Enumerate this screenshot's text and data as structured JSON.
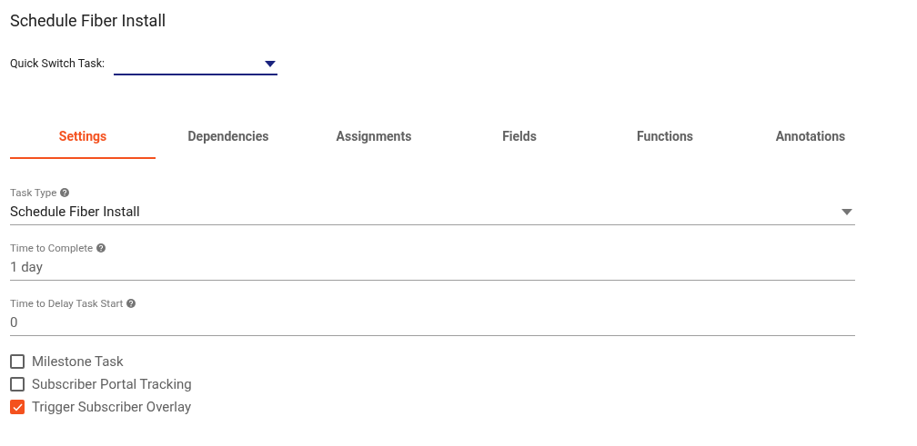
{
  "page": {
    "title": "Schedule Fiber Install"
  },
  "quick_switch": {
    "label": "Quick Switch Task:"
  },
  "tabs": [
    {
      "label": "Settings",
      "selected": true
    },
    {
      "label": "Dependencies",
      "selected": false
    },
    {
      "label": "Assignments",
      "selected": false
    },
    {
      "label": "Fields",
      "selected": false
    },
    {
      "label": "Functions",
      "selected": false
    },
    {
      "label": "Annotations",
      "selected": false
    }
  ],
  "fields": [
    {
      "kind": "select",
      "label": "Task Type",
      "value": "Schedule Fiber Install"
    },
    {
      "kind": "text",
      "label": "Time to Complete",
      "value": "1 day"
    },
    {
      "kind": "text",
      "label": "Time to Delay Task Start",
      "value": "0"
    }
  ],
  "checkboxes": [
    {
      "label": "Milestone Task",
      "checked": false
    },
    {
      "label": "Subscriber Portal Tracking",
      "checked": false
    },
    {
      "label": "Trigger Subscriber Overlay",
      "checked": true
    }
  ]
}
